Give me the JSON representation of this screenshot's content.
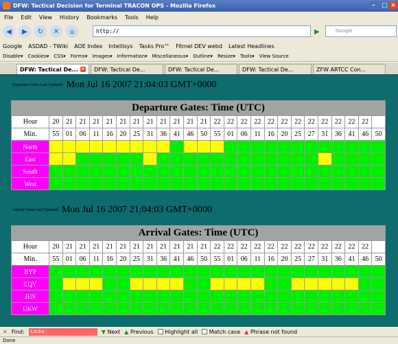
{
  "window": {
    "title": "DFW: Tactical Decision for Terminal TRACON OPS - Mozilla Firefox"
  },
  "menu": [
    "File",
    "Edit",
    "View",
    "History",
    "Bookmarks",
    "Tools",
    "Help"
  ],
  "nav": {
    "url": "http://",
    "search_placeholder": "Google"
  },
  "bookmarks": [
    "Google",
    "ASDAD - TWiki",
    "AOE Index",
    "Intellisys",
    "Tasks Pro™",
    "Fitmel DEV webd",
    "Latest Headlines"
  ],
  "devbar": [
    "Disable▾",
    "Cookies▾",
    "CSS▾",
    "Forms▾",
    "Images▾",
    "Information▾",
    "Miscellaneous▾",
    "Outline▾",
    "Resize▾",
    "Tools▾",
    "View Source"
  ],
  "tabs": [
    "DFW: Tactical De...",
    "DFW: Tactical De...",
    "DFW: Tactical De...",
    "DFW: Tactical De...",
    "ZFW ARTCC Con..."
  ],
  "departure": {
    "updated_label": "Departure Gates Last Updated:",
    "updated_time": "Mon Jul 16 2007 21:04:03 GMT+0000",
    "title": "Departure Gates: Time (UTC)",
    "hour_label": "Hour",
    "min_label": "Min.",
    "hours": [
      "20",
      "21",
      "21",
      "21",
      "21",
      "21",
      "21",
      "21",
      "21",
      "21",
      "21",
      "21",
      "22",
      "22",
      "22",
      "22",
      "22",
      "22",
      "22",
      "22",
      "22",
      "22",
      "22",
      "22"
    ],
    "mins": [
      "55",
      "01",
      "06",
      "11",
      "16",
      "20",
      "25",
      "31",
      "36",
      "41",
      "46",
      "50",
      "55",
      "01",
      "06",
      "11",
      "16",
      "20",
      "25",
      "27",
      "31",
      "36",
      "41",
      "46",
      "50"
    ],
    "rows": [
      {
        "name": "North",
        "cells": "yyyyyyyyygyyyggggggggggggg"
      },
      {
        "name": "East",
        "cells": "yygggggyggggggggggggyggggg"
      },
      {
        "name": "South",
        "cells": "gggggggggggggggggggggggggg"
      },
      {
        "name": "West",
        "cells": "gggggggggggggggggggggggggg"
      }
    ]
  },
  "arrival": {
    "updated_label": "Arrival Gates Last Updated:",
    "updated_time": "Mon Jul 16 2007 21:04:03 GMT+0000",
    "title": "Arrival Gates: Time (UTC)",
    "hour_label": "Hour",
    "min_label": "Min.",
    "hours": [
      "20",
      "21",
      "21",
      "21",
      "21",
      "21",
      "21",
      "21",
      "21",
      "21",
      "21",
      "21",
      "22",
      "22",
      "22",
      "22",
      "22",
      "22",
      "22",
      "22",
      "22",
      "22",
      "22",
      "22"
    ],
    "mins": [
      "55",
      "01",
      "06",
      "11",
      "16",
      "20",
      "25",
      "31",
      "36",
      "41",
      "46",
      "50",
      "55",
      "01",
      "06",
      "11",
      "16",
      "20",
      "25",
      "27",
      "31",
      "36",
      "41",
      "46",
      "50"
    ],
    "rows": [
      {
        "name": "BYP",
        "cells": "gggggggggggggggggggggggggg"
      },
      {
        "name": "CQY",
        "cells": "gyyyggyyyyggyyyyggyyyyygggg"
      },
      {
        "name": "JEN",
        "cells": "gggggggggggggggggggggggggg"
      },
      {
        "name": "UKW",
        "cells": "gggggggggggggggggggggggggg"
      }
    ]
  },
  "find": {
    "label": "Find:",
    "value": "Locks",
    "next": "Next",
    "previous": "Previous",
    "highlight": "Highlight all",
    "match": "Match case",
    "status": "Phrase not found"
  },
  "status": "Done",
  "colors": {
    "ok": "#00ee00",
    "warn": "#ffff00",
    "gate_label": "#ff00ff",
    "page_bg": "#0e6b6e"
  }
}
